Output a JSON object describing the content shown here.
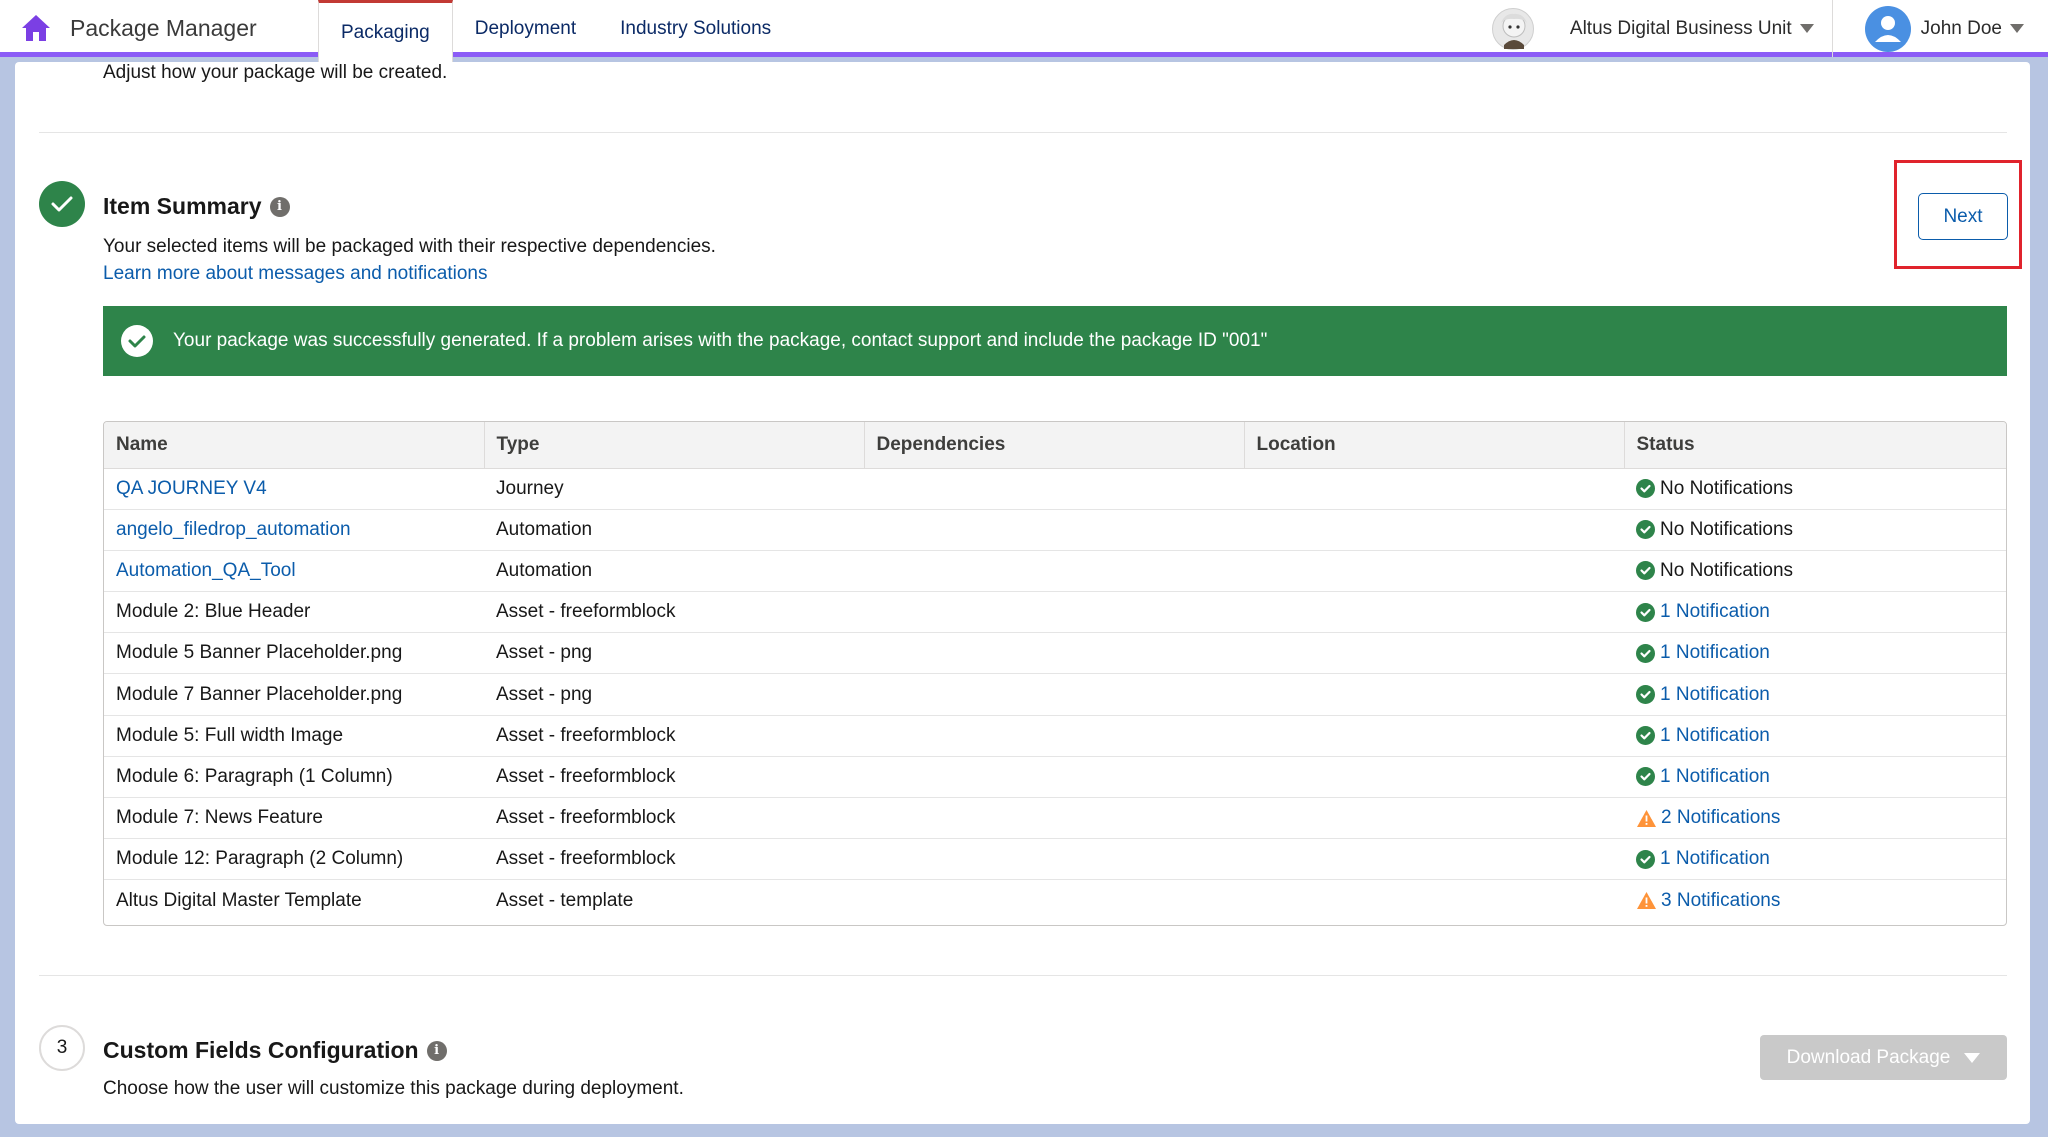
{
  "app": {
    "title": "Package Manager",
    "accent_color": "#8b5cf6",
    "tabs": [
      {
        "label": "Packaging",
        "active": true
      },
      {
        "label": "Deployment",
        "active": false
      },
      {
        "label": "Industry Solutions",
        "active": false
      }
    ],
    "business_unit": "Altus Digital Business Unit",
    "user_name": "John Doe"
  },
  "intro": {
    "text": "Adjust how your package will be created."
  },
  "item_summary": {
    "title": "Item Summary",
    "description": "Your selected items will be packaged with their respective dependencies.",
    "learn_more_link": "Learn more about messages and notifications",
    "next_label": "Next",
    "banner_text": "Your package was successfully generated. If a problem arises with the package, contact support and include the package ID \"001\"",
    "banner_color": "#2e844a"
  },
  "table": {
    "columns": [
      "Name",
      "Type",
      "Dependencies",
      "Location",
      "Status"
    ],
    "rows": [
      {
        "name": "QA JOURNEY V4",
        "name_link": true,
        "type": "Journey",
        "dependencies": "",
        "location": "",
        "status": "No Notifications",
        "status_kind": "ok",
        "status_link": false
      },
      {
        "name": "angelo_filedrop_automation",
        "name_link": true,
        "type": "Automation",
        "dependencies": "",
        "location": "",
        "status": "No Notifications",
        "status_kind": "ok",
        "status_link": false
      },
      {
        "name": "Automation_QA_Tool",
        "name_link": true,
        "type": "Automation",
        "dependencies": "",
        "location": "",
        "status": "No Notifications",
        "status_kind": "ok",
        "status_link": false
      },
      {
        "name": "Module 2: Blue Header",
        "name_link": false,
        "type": "Asset - freeformblock",
        "dependencies": "",
        "location": "",
        "status": "1 Notification",
        "status_kind": "ok",
        "status_link": true
      },
      {
        "name": "Module 5 Banner Placeholder.png",
        "name_link": false,
        "type": "Asset - png",
        "dependencies": "",
        "location": "",
        "status": "1 Notification",
        "status_kind": "ok",
        "status_link": true
      },
      {
        "name": "Module 7 Banner Placeholder.png",
        "name_link": false,
        "type": "Asset - png",
        "dependencies": "",
        "location": "",
        "status": "1 Notification",
        "status_kind": "ok",
        "status_link": true
      },
      {
        "name": "Module 5: Full width Image",
        "name_link": false,
        "type": "Asset - freeformblock",
        "dependencies": "",
        "location": "",
        "status": "1 Notification",
        "status_kind": "ok",
        "status_link": true
      },
      {
        "name": "Module 6: Paragraph (1 Column)",
        "name_link": false,
        "type": "Asset - freeformblock",
        "dependencies": "",
        "location": "",
        "status": "1 Notification",
        "status_kind": "ok",
        "status_link": true
      },
      {
        "name": "Module 7: News Feature",
        "name_link": false,
        "type": "Asset - freeformblock",
        "dependencies": "",
        "location": "",
        "status": "2 Notifications",
        "status_kind": "warning",
        "status_link": true
      },
      {
        "name": "Module 12: Paragraph (2 Column)",
        "name_link": false,
        "type": "Asset - freeformblock",
        "dependencies": "",
        "location": "",
        "status": "1 Notification",
        "status_kind": "ok",
        "status_link": true
      },
      {
        "name": "Altus Digital Master Template",
        "name_link": false,
        "type": "Asset - template",
        "dependencies": "",
        "location": "",
        "status": "3 Notifications",
        "status_kind": "warning",
        "status_link": true
      }
    ]
  },
  "custom_fields": {
    "step_number": "3",
    "title": "Custom Fields Configuration",
    "description": "Choose how the user will customize this package during deployment.",
    "download_label": "Download Package"
  }
}
